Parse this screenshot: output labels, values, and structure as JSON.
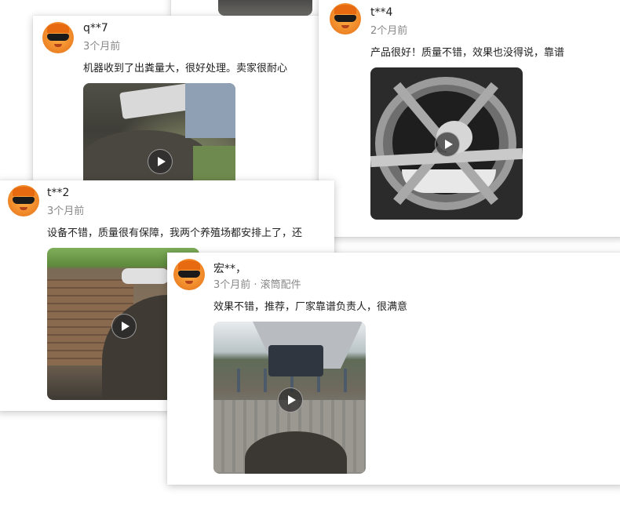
{
  "reviews": [
    {
      "user": "q**7",
      "meta": "3个月前",
      "comment": "机器收到了出粪量大，很好处理。卖家很耐心"
    },
    {
      "user": "t**4",
      "meta": "2个月前",
      "comment": "产品很好！质量不错，效果也没得说，靠谱"
    },
    {
      "user": "t**2",
      "meta": "3个月前",
      "comment": "设备不错，质量很有保障，我两个养殖场都安排上了，还"
    },
    {
      "user": "宏**，",
      "meta": "3个月前 · 滚筒配件",
      "comment": "效果不错，推荐，厂家靠谱负责人，很满意"
    }
  ],
  "icons": {
    "avatar": "avatar-icon",
    "play": "play-icon"
  }
}
